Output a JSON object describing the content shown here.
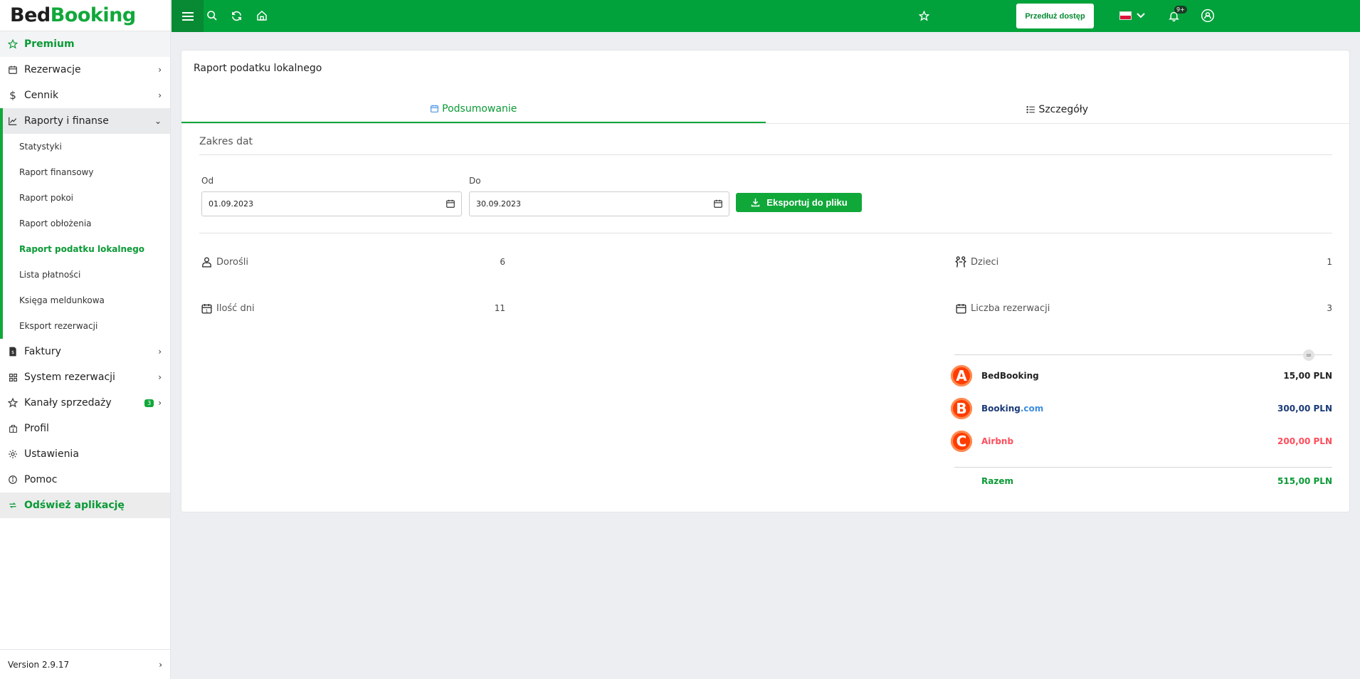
{
  "brand": {
    "part1": "Bed",
    "part2": "Booking"
  },
  "sidebar": {
    "premium": "Premium",
    "items": [
      {
        "label": "Rezerwacje"
      },
      {
        "label": "Cennik"
      },
      {
        "label": "Raporty i finanse"
      }
    ],
    "sub_items": [
      "Statystyki",
      "Raport finansowy",
      "Raport pokoi",
      "Raport obłożenia",
      "Raport podatku lokalnego",
      "Lista płatności",
      "Księga meldunkowa",
      "Eksport rezerwacji"
    ],
    "lower_items": [
      {
        "label": "Faktury"
      },
      {
        "label": "System rezerwacji"
      },
      {
        "label": "Kanały sprzedaży",
        "badge": "3"
      },
      {
        "label": "Profil"
      },
      {
        "label": "Ustawienia"
      },
      {
        "label": "Pomoc"
      }
    ],
    "refresh": "Odśwież aplikację",
    "version": "Version 2.9.17"
  },
  "topbar": {
    "extend_button": "Przedłuż dostęp",
    "notification_badge": "9+"
  },
  "report": {
    "title": "Raport podatku lokalnego",
    "tabs": [
      "Podsumowanie",
      "Szczegóły"
    ],
    "date_range_title": "Zakres dat",
    "from_label": "Od",
    "from_value": "01.09.2023",
    "to_label": "Do",
    "to_value": "30.09.2023",
    "export_button": "Eksportuj do pliku",
    "stats": {
      "adults_label": "Dorośli",
      "adults_value": "6",
      "children_label": "Dzieci",
      "children_value": "1",
      "days_label": "Ilość dni",
      "days_value": "11",
      "reservations_label": "Liczba rezerwacji",
      "reservations_value": "3"
    },
    "channels": [
      {
        "logo": "A",
        "name": "BedBooking",
        "amount": "15,00 PLN",
        "color": "#222222"
      },
      {
        "logo": "B",
        "name_main": "Booking",
        "name_suffix": ".com",
        "amount": "300,00 PLN",
        "color": "#1a3a78",
        "suffix_color": "#3d8de0"
      },
      {
        "logo": "C",
        "name": "Airbnb",
        "amount": "200,00 PLN",
        "color": "#ff4d5b"
      }
    ],
    "total_label": "Razem",
    "total_value": "515,00 PLN"
  },
  "colors": {
    "primary": "#01a23b",
    "accent_text": "#0b9a36"
  }
}
